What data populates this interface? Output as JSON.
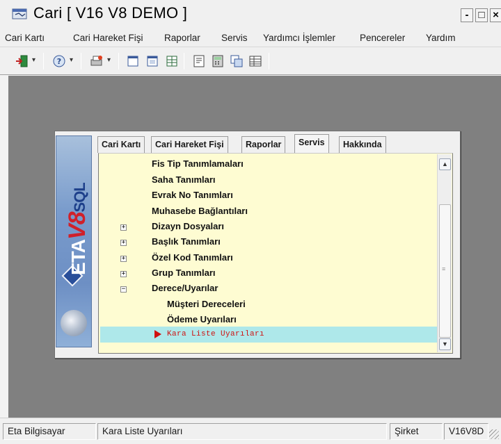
{
  "window": {
    "title": "Cari [ V16 V8 DEMO ]",
    "min_glyph": "-",
    "max_glyph": "□",
    "close_glyph": "×"
  },
  "menu": [
    "Cari Kartı",
    "Cari Hareket Fişi",
    "Raporlar",
    "Servis",
    "Yardımcı İşlemler",
    "Pencereler",
    "Yardım"
  ],
  "toolbar": {
    "icons": [
      "exit-door-icon",
      "help-icon",
      "print-setup-icon",
      "window-tile-icon",
      "window-cascade-icon",
      "window-grid-icon",
      "form-icon",
      "calculator-icon",
      "copy-windows-icon",
      "table-icon"
    ],
    "dropdown_glyph": "▾"
  },
  "logo": {
    "eta": "ETA",
    "v8": "V8",
    "sql": "SQL"
  },
  "tabs": [
    "Cari Kartı",
    "Cari Hareket Fişi",
    "Raporlar",
    "Servis",
    "Hakkında"
  ],
  "active_tab": "Servis",
  "tree": {
    "items": [
      {
        "label": "Fis Tip Tanımlamaları",
        "expander": ""
      },
      {
        "label": "Saha Tanımları",
        "expander": ""
      },
      {
        "label": "Evrak No Tanımları",
        "expander": ""
      },
      {
        "label": "Muhasebe Bağlantıları",
        "expander": ""
      },
      {
        "label": "Dizayn Dosyaları",
        "expander": "+"
      },
      {
        "label": "Başlık Tanımları",
        "expander": "+"
      },
      {
        "label": "Özel Kod Tanımları",
        "expander": "+"
      },
      {
        "label": "Grup Tanımları",
        "expander": "+"
      },
      {
        "label": "Derece/Uyarılar",
        "expander": "−"
      },
      {
        "label": "Müşteri Dereceleri",
        "expander": ""
      },
      {
        "label": "Ödeme Uyarıları",
        "expander": ""
      }
    ],
    "selected": "Kara Liste Uyarıları"
  },
  "scrollbar": {
    "up_glyph": "▲",
    "down_glyph": "▼",
    "grip_glyph": "≡"
  },
  "status": {
    "company": "Eta Bilgisayar",
    "current": "Kara Liste Uyarıları",
    "sirket": "Şirket",
    "code": "V16V8D"
  },
  "colors": {
    "list_bg": "#fefcd2",
    "selection_bg": "#aee8ea",
    "selection_text": "#d01010",
    "workspace_bg": "#808080"
  }
}
